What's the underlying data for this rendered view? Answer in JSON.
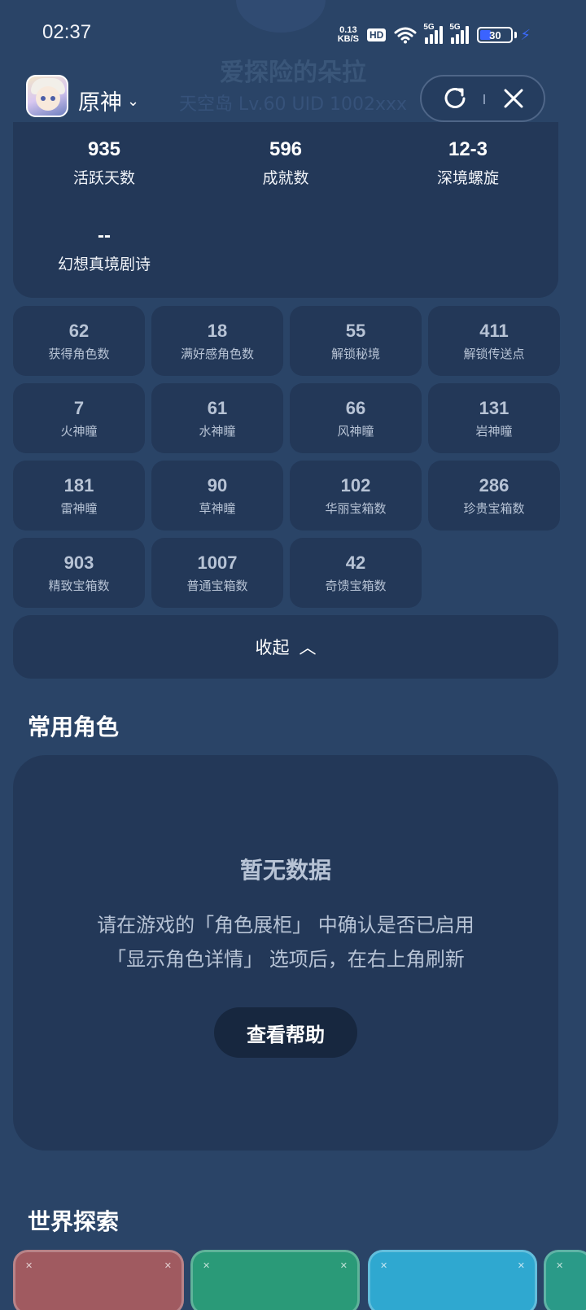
{
  "background_header": {
    "name": "爱探险的朵拉",
    "subtitle": "天空岛 Lv.60 UID 1002xxx"
  },
  "status_bar": {
    "time": "02:37",
    "net_speed_value": "0.13",
    "net_speed_unit": "KB/S",
    "hd": "HD",
    "signal1": "5G",
    "signal2": "5G",
    "battery": "30"
  },
  "top_bar": {
    "title": "原神",
    "dropdown_glyph": "⌄",
    "refresh_icon": "refresh-icon",
    "close_icon": "close-icon"
  },
  "summary_stats": [
    {
      "value": "935",
      "label": "活跃天数"
    },
    {
      "value": "596",
      "label": "成就数"
    },
    {
      "value": "12-3",
      "label": "深境螺旋"
    },
    {
      "value": "--",
      "label": "幻想真境剧诗"
    }
  ],
  "detail_stats": [
    {
      "value": "62",
      "label": "获得角色数"
    },
    {
      "value": "18",
      "label": "满好感角色数"
    },
    {
      "value": "55",
      "label": "解锁秘境"
    },
    {
      "value": "411",
      "label": "解锁传送点"
    },
    {
      "value": "7",
      "label": "火神瞳"
    },
    {
      "value": "61",
      "label": "水神瞳"
    },
    {
      "value": "66",
      "label": "风神瞳"
    },
    {
      "value": "131",
      "label": "岩神瞳"
    },
    {
      "value": "181",
      "label": "雷神瞳"
    },
    {
      "value": "90",
      "label": "草神瞳"
    },
    {
      "value": "102",
      "label": "华丽宝箱数"
    },
    {
      "value": "286",
      "label": "珍贵宝箱数"
    },
    {
      "value": "903",
      "label": "精致宝箱数"
    },
    {
      "value": "1007",
      "label": "普通宝箱数"
    },
    {
      "value": "42",
      "label": "奇馈宝箱数"
    }
  ],
  "collapse": {
    "label": "收起",
    "glyph": "︿"
  },
  "characters_section": {
    "title": "常用角色",
    "empty_title": "暂无数据",
    "empty_line1": "请在游戏的「角色展柜」 中确认是否已启用",
    "empty_line2": "「显示角色详情」 选项后，在右上角刷新",
    "help_button": "查看帮助"
  },
  "explore_section": {
    "title": "世界探索",
    "card_colors": [
      "#a05a60",
      "#2a9a78",
      "#2fa8d0",
      "#2a9a88"
    ]
  },
  "colors": {
    "background": "#2a4467",
    "card": "#233858",
    "muted_text": "#b7c3d5",
    "battery_accent": "#3b63ff"
  }
}
